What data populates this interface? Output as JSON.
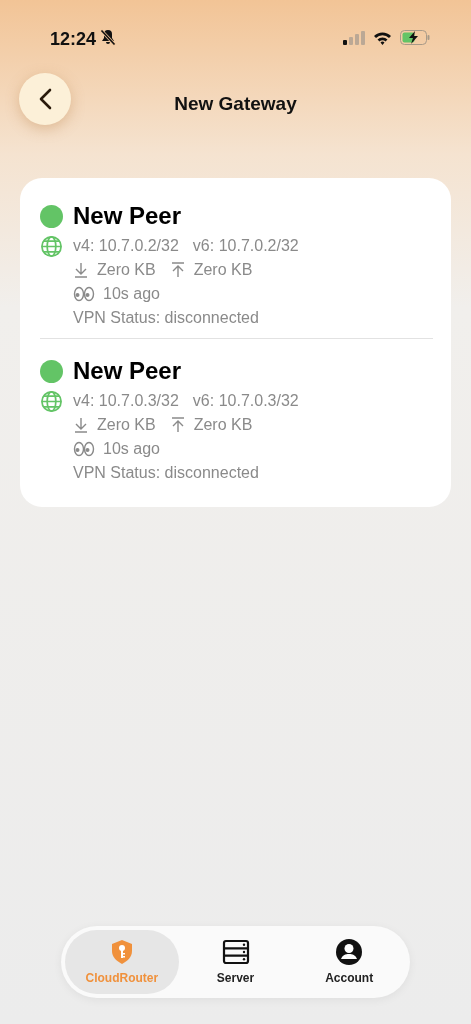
{
  "status_bar": {
    "time": "12:24"
  },
  "header": {
    "title": "New Gateway"
  },
  "peers": [
    {
      "name": "New Peer",
      "color": "#63c466",
      "v4": "v4: 10.7.0.2/32",
      "v6": "v6: 10.7.0.2/32",
      "download": "Zero KB",
      "upload": "Zero KB",
      "last_seen": "10s ago",
      "vpn_status": "VPN Status: disconnected"
    },
    {
      "name": "New Peer",
      "color": "#63c466",
      "v4": "v4: 10.7.0.3/32",
      "v6": "v6: 10.7.0.3/32",
      "download": "Zero KB",
      "upload": "Zero KB",
      "last_seen": "10s ago",
      "vpn_status": "VPN Status: disconnected"
    }
  ],
  "tabs": [
    {
      "label": "CloudRouter",
      "kind": "shield",
      "selected": true
    },
    {
      "label": "Server",
      "kind": "server",
      "selected": false
    },
    {
      "label": "Account",
      "kind": "account",
      "selected": false
    }
  ]
}
